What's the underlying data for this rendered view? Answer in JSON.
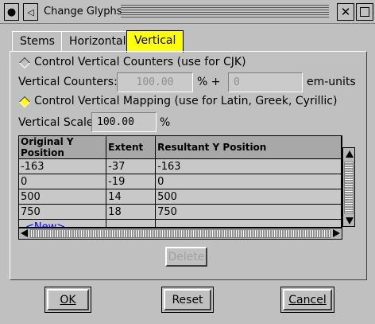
{
  "window": {
    "title": "Change Glyphs",
    "menu_icon": "●",
    "shade_icon": "◁",
    "close_icon": "✕"
  },
  "tabs": [
    {
      "label": "Stems",
      "active": false
    },
    {
      "label": "Horizontal",
      "active": false
    },
    {
      "label": "Vertical",
      "active": true
    }
  ],
  "counters": {
    "option_label": "Control Vertical Counters (use for CJK)",
    "field_label": "Vertical Counters:",
    "percent_value": "100.00",
    "percent_suffix": "% +",
    "em_value": "0",
    "em_suffix": "em-units"
  },
  "mapping": {
    "option_label": "Control Vertical Mapping (use for Latin, Greek, Cyrillic)",
    "scale_label": "Vertical Scale:",
    "scale_value": "100.00",
    "scale_suffix": "%"
  },
  "table": {
    "headers": [
      "Original Y Position",
      "Extent",
      "Resultant Y Position"
    ],
    "rows": [
      [
        "-163",
        "-37",
        "-163"
      ],
      [
        "0",
        "-19",
        "0"
      ],
      [
        "500",
        "14",
        "500"
      ],
      [
        "750",
        "18",
        "750"
      ]
    ],
    "new_label": "<New>"
  },
  "buttons": {
    "delete": "Delete",
    "ok": "OK",
    "reset": "Reset",
    "cancel": "Cancel"
  },
  "colors": {
    "active_tab": "#ffff00",
    "new_link": "#0000ee",
    "selected_radio": "#ffff00"
  }
}
